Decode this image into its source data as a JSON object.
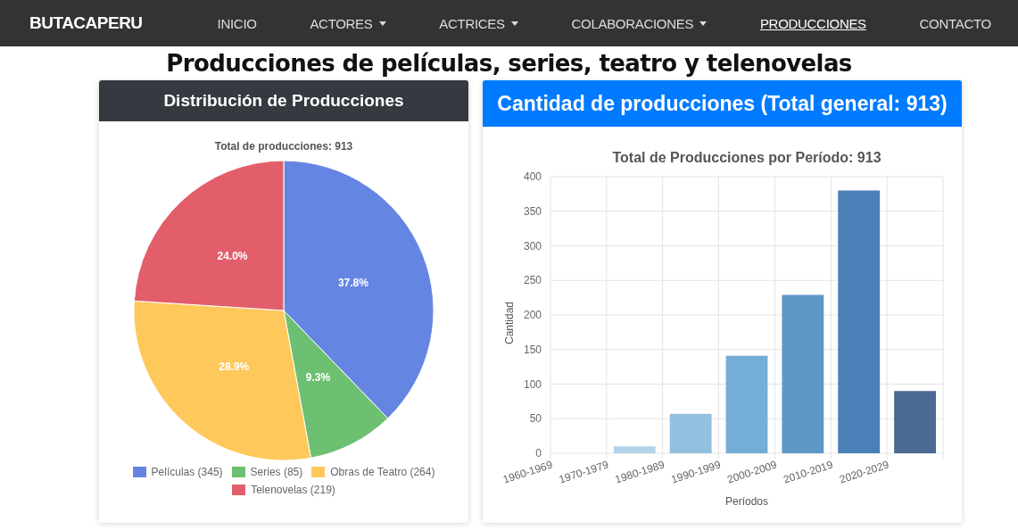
{
  "navbar": {
    "brand": "BUTACAPERU",
    "items": [
      {
        "label": "INICIO",
        "dropdown": false,
        "selected": false
      },
      {
        "label": "ACTORES",
        "dropdown": true,
        "selected": false
      },
      {
        "label": "ACTRICES",
        "dropdown": true,
        "selected": false
      },
      {
        "label": "COLABORACIONES",
        "dropdown": true,
        "selected": false
      },
      {
        "label": "PRODUCCIONES",
        "dropdown": false,
        "selected": true
      },
      {
        "label": "CONTACTO",
        "dropdown": false,
        "selected": false
      }
    ]
  },
  "page_title": "Producciones de películas, series, teatro y telenovelas",
  "distribution_card": {
    "header": "Distribución de Producciones",
    "chart_data": {
      "type": "pie",
      "title": "Total de producciones: 913",
      "categories": [
        "Películas (345)",
        "Series (85)",
        "Obras de Teatro (264)",
        "Telenovelas (219)"
      ],
      "series": [
        {
          "colors": [
            "#6585e3",
            "#6dbf71",
            "#fec85a",
            "#e35e6b"
          ],
          "values": [
            345,
            85,
            264,
            219
          ]
        }
      ],
      "value_labels": [
        "37.8%",
        "9.3%",
        "28.9%",
        "24.0%"
      ]
    }
  },
  "quantity_card": {
    "header": "Cantidad de producciones (Total general: 913)",
    "chart_data": {
      "type": "bar",
      "title": "Total de Producciones por Período: 913",
      "xlabel": "Períodos",
      "ylabel": "Cantidad",
      "categories": [
        "1960-1969",
        "1970-1979",
        "1980-1989",
        "1990-1999",
        "2000-2009",
        "2010-2019",
        "2020-2029"
      ],
      "series": [
        {
          "colors": [
            "#c6dbef",
            "#b3d3e8",
            "#92c0df",
            "#74add5",
            "#5f97c8",
            "#4a7fb8",
            "#4c6994"
          ],
          "values": [
            0,
            10,
            57,
            141,
            229,
            380,
            90
          ]
        }
      ],
      "grid": true,
      "ylim": [
        0,
        400
      ],
      "yticks": [
        0,
        50,
        100,
        150,
        200,
        250,
        300,
        350,
        400
      ]
    }
  }
}
